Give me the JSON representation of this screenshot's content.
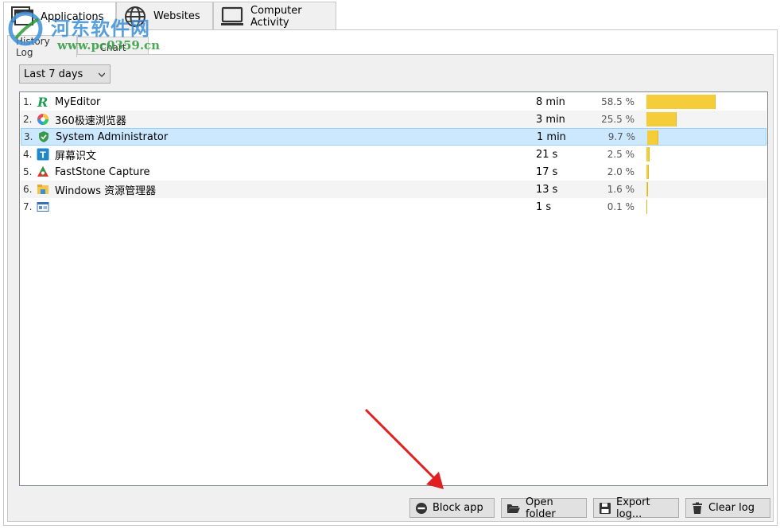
{
  "tabs": [
    {
      "label": "Applications",
      "icon": "applications-icon",
      "active": true
    },
    {
      "label": "Websites",
      "icon": "globe-icon",
      "active": false
    },
    {
      "label": "Computer Activity",
      "icon": "monitor-icon",
      "active": false
    }
  ],
  "subtabs": [
    {
      "label": "History Log",
      "active": true
    },
    {
      "label": "Chart",
      "active": false
    }
  ],
  "period": {
    "selected": "Last 7 days"
  },
  "apps": [
    {
      "rank": "1.",
      "name": "MyEditor",
      "duration": "8 min",
      "percent": "58.5 %",
      "share": 58.5,
      "icon": "myeditor-icon"
    },
    {
      "rank": "2.",
      "name": "360极速浏览器",
      "duration": "3 min",
      "percent": "25.5 %",
      "share": 25.5,
      "icon": "browser-icon"
    },
    {
      "rank": "3.",
      "name": "System Administrator",
      "duration": "1 min",
      "percent": "9.7 %",
      "share": 9.7,
      "icon": "shield-icon",
      "selected": true
    },
    {
      "rank": "4.",
      "name": "屏幕识文",
      "duration": "21 s",
      "percent": "2.5 %",
      "share": 2.5,
      "icon": "text-t-icon"
    },
    {
      "rank": "5.",
      "name": "FastStone Capture",
      "duration": "17 s",
      "percent": "2.0 %",
      "share": 2.0,
      "icon": "capture-icon"
    },
    {
      "rank": "6.",
      "name": "Windows 资源管理器",
      "duration": "13 s",
      "percent": "1.6 %",
      "share": 1.6,
      "icon": "folder-icon"
    },
    {
      "rank": "7.",
      "name": "",
      "duration": "1 s",
      "percent": "0.1 %",
      "share": 0.1,
      "icon": "window-icon"
    }
  ],
  "buttons": {
    "block": "Block app",
    "open_folder": "Open folder",
    "export": "Export log...",
    "clear": "Clear log"
  },
  "watermark": {
    "title": "河东软件网",
    "url": "www.pc0359.cn"
  },
  "colors": {
    "bar": "#f5cd3a",
    "selection": "#cce8ff",
    "arrow": "#e02020"
  }
}
